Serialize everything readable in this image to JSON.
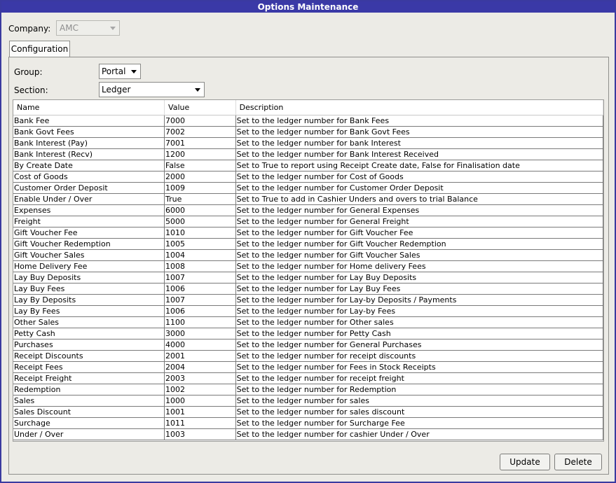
{
  "window": {
    "title": "Options Maintenance"
  },
  "company": {
    "label": "Company:",
    "value": "AMC"
  },
  "tabs": [
    {
      "label": "Configuration"
    }
  ],
  "group": {
    "label": "Group:",
    "value": "Portal"
  },
  "section": {
    "label": "Section:",
    "value": "Ledger"
  },
  "table": {
    "columns": [
      "Name",
      "Value",
      "Description"
    ],
    "rows": [
      [
        "Bank Fee",
        "7000",
        "Set to the ledger number for Bank Fees"
      ],
      [
        "Bank Govt Fees",
        "7002",
        "Set to the ledger number for Bank Govt Fees"
      ],
      [
        "Bank Interest (Pay)",
        "7001",
        "Set to the ledger number for bank Interest"
      ],
      [
        "Bank Interest (Recv)",
        "1200",
        "Set to the ledger number for Bank Interest Received"
      ],
      [
        "By Create Date",
        "False",
        "Set to True to report using Receipt Create date, False for Finalisation date"
      ],
      [
        "Cost of Goods",
        "2000",
        "Set to the ledger number for Cost of Goods"
      ],
      [
        "Customer Order Deposit",
        "1009",
        "Set to the ledger number for Customer Order Deposit"
      ],
      [
        "Enable Under / Over",
        "True",
        "Set to True to add in Cashier Unders and overs to trial Balance"
      ],
      [
        "Expenses",
        "6000",
        "Set to the ledger number for General Expenses"
      ],
      [
        "Freight",
        "5000",
        "Set to the ledger number for General Freight"
      ],
      [
        "Gift Voucher Fee",
        "1010",
        "Set to the ledger number for Gift Voucher Fee"
      ],
      [
        "Gift Voucher Redemption",
        "1005",
        "Set to the ledger number for Gift Voucher Redemption"
      ],
      [
        "Gift Voucher Sales",
        "1004",
        "Set to the ledger number for Gift Voucher Sales"
      ],
      [
        "Home Delivery Fee",
        "1008",
        "Set to the ledger number for Home delivery Fees"
      ],
      [
        "Lay Buy Deposits",
        "1007",
        "Set to the ledger number for Lay Buy Deposits"
      ],
      [
        "Lay Buy Fees",
        "1006",
        "Set to the ledger number for Lay Buy Fees"
      ],
      [
        "Lay By Deposits",
        "1007",
        "Set to the ledger number for Lay-by Deposits / Payments"
      ],
      [
        "Lay By Fees",
        "1006",
        "Set to the ledger number for Lay-by Fees"
      ],
      [
        "Other Sales",
        "1100",
        "Set to the ledger number for Other sales"
      ],
      [
        "Petty Cash",
        "3000",
        "Set to the ledger number for Petty Cash"
      ],
      [
        "Purchases",
        "4000",
        "Set to the ledger number for General Purchases"
      ],
      [
        "Receipt Discounts",
        "2001",
        "Set to the ledger number for receipt discounts"
      ],
      [
        "Receipt Fees",
        "2004",
        "Set to the ledger number for Fees in Stock Receipts"
      ],
      [
        "Receipt Freight",
        "2003",
        "Set to the ledger number for receipt freight"
      ],
      [
        "Redemption",
        "1002",
        "Set to the ledger number for Redemption"
      ],
      [
        "Sales",
        "1000",
        "Set to the ledger number for sales"
      ],
      [
        "Sales Discount",
        "1001",
        "Set to the ledger number for sales discount"
      ],
      [
        "Surchage",
        "1011",
        "Set to the ledger number for Surcharge Fee"
      ],
      [
        "Under / Over",
        "1003",
        "Set to the ledger number for cashier Under / Over"
      ]
    ]
  },
  "buttons": {
    "update": "Update",
    "delete": "Delete"
  }
}
